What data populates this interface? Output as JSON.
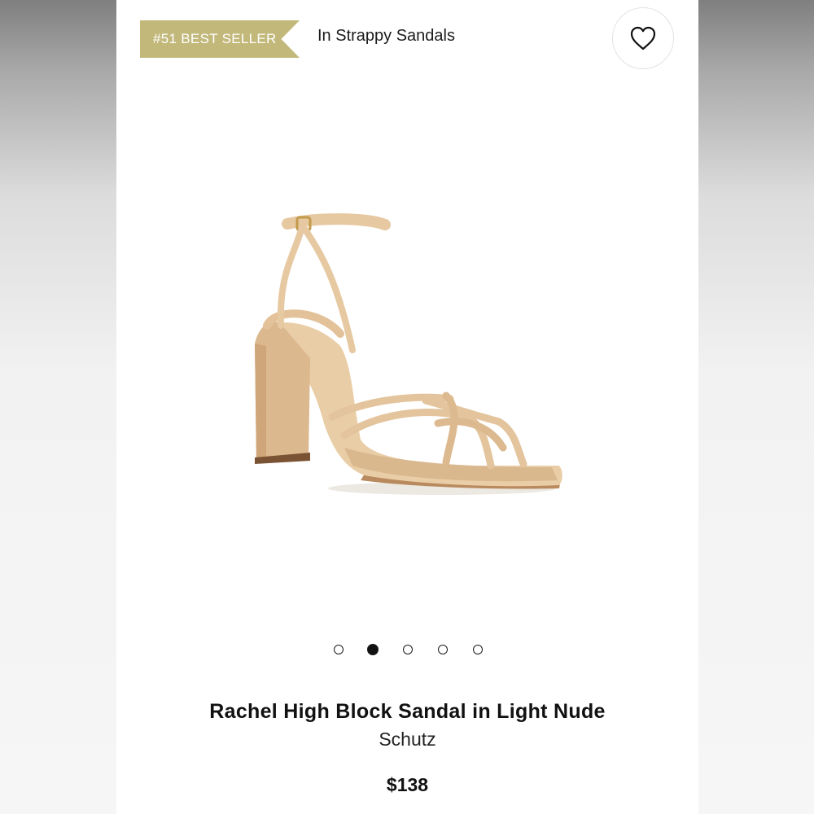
{
  "badge": {
    "text": "#51 BEST SELLER",
    "color": "#c2b87a"
  },
  "category": {
    "label": "In Strappy Sandals"
  },
  "favorite": {
    "icon": "heart-outline-icon"
  },
  "carousel": {
    "total": 5,
    "active_index": 1
  },
  "product": {
    "title": "Rachel High Block Sandal in Light Nude",
    "brand": "Schutz",
    "price": "$138",
    "image": "strappy-block-heel-sandal"
  },
  "colors": {
    "sandal": "#e6c7a0",
    "accent": "#c2b87a"
  }
}
